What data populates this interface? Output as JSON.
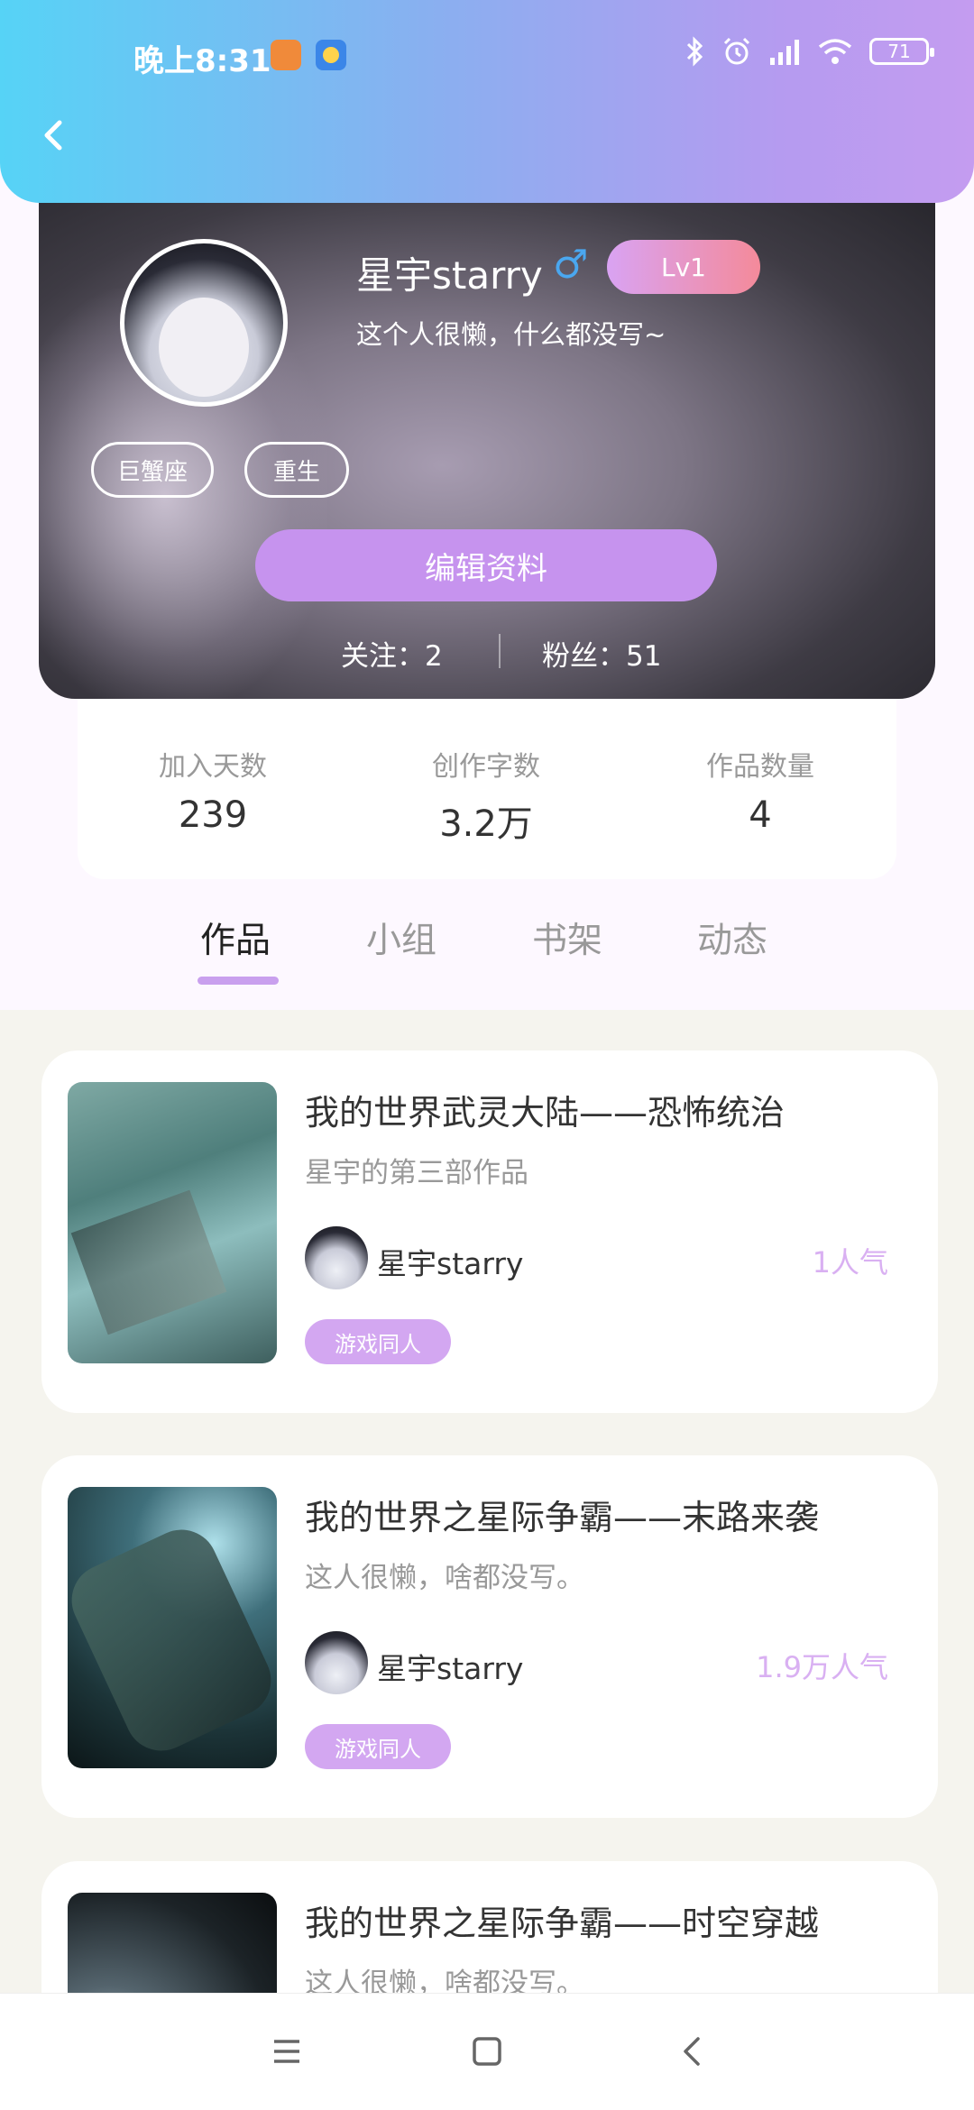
{
  "status_bar": {
    "time": "晚上8:31",
    "battery": "71"
  },
  "profile": {
    "name": "星宇starry",
    "gender_symbol": "♂",
    "level": "Lv1",
    "bio": "这个人很懒，什么都没写~",
    "tags": [
      "巨蟹座",
      "重生"
    ],
    "edit_label": "编辑资料",
    "following": "关注：2",
    "fans": "粉丝：51"
  },
  "stats": [
    {
      "label": "加入天数",
      "value": "239"
    },
    {
      "label": "创作字数",
      "value": "3.2万"
    },
    {
      "label": "作品数量",
      "value": "4"
    }
  ],
  "tabs": [
    "作品",
    "小组",
    "书架",
    "动态"
  ],
  "works": [
    {
      "title": "我的世界武灵大陆——恐怖统治",
      "subtitle": "星宇的第三部作品",
      "author": "星宇starry",
      "popularity": "1人气",
      "genre": "游戏同人"
    },
    {
      "title": "我的世界之星际争霸——末路来袭",
      "subtitle": "这人很懒，啥都没写。",
      "author": "星宇starry",
      "popularity": "1.9万人气",
      "genre": "游戏同人"
    },
    {
      "title": "我的世界之星际争霸——时空穿越",
      "subtitle": "这人很懒，啥都没写。"
    }
  ],
  "colors": {
    "accent": "#c693ee",
    "header_gradient_start": "#56d3f6",
    "header_gradient_end": "#c49cf0",
    "popularity": "#d9b0f2"
  }
}
